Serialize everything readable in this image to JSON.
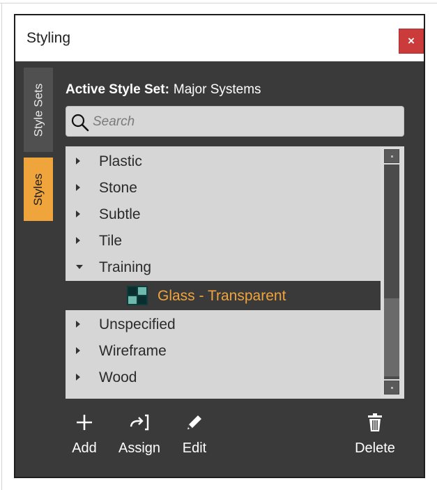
{
  "window": {
    "title": "Styling",
    "close_label": "×"
  },
  "tabs": [
    {
      "label": "Style Sets",
      "active": false
    },
    {
      "label": "Styles",
      "active": true
    }
  ],
  "active_style_set": {
    "label": "Active Style Set:",
    "value": "Major Systems"
  },
  "search": {
    "placeholder": "Search"
  },
  "tree": {
    "items": [
      {
        "label": "Plastic",
        "expanded": false
      },
      {
        "label": "Stone",
        "expanded": false
      },
      {
        "label": "Subtle",
        "expanded": false
      },
      {
        "label": "Tile",
        "expanded": false
      },
      {
        "label": "Training",
        "expanded": true
      },
      {
        "label": "Glass - Transparent",
        "selected": true,
        "icon": "style-swatch-icon"
      },
      {
        "label": "Unspecified",
        "expanded": false
      },
      {
        "label": "Wireframe",
        "expanded": false
      },
      {
        "label": "Wood",
        "expanded": false
      }
    ]
  },
  "toolbar": {
    "add": "Add",
    "assign": "Assign",
    "edit": "Edit",
    "delete": "Delete"
  },
  "colors": {
    "accent": "#f0a43c",
    "close": "#cc3b3b",
    "panel": "#3a3a3a"
  }
}
